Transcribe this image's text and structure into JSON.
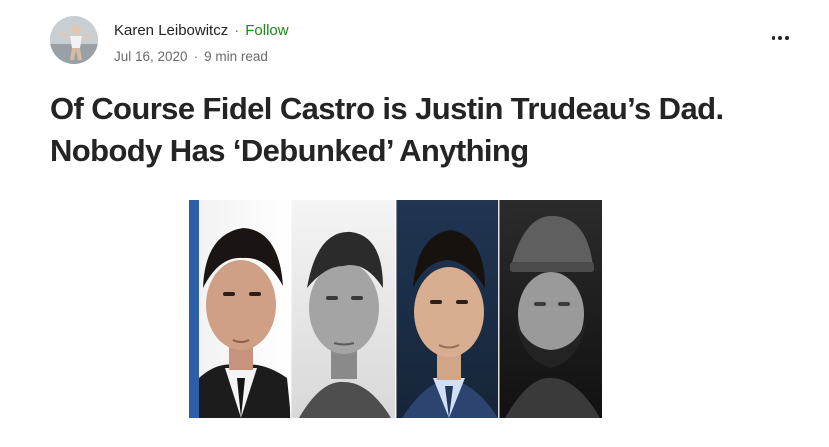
{
  "author": {
    "name": "Karen Leibowitcz",
    "separator": "·",
    "follow_label": "Follow"
  },
  "meta": {
    "date": "Jul 16, 2020",
    "separator": "·",
    "read_time": "9 min read"
  },
  "menu": {
    "icon": "more-horizontal-icon"
  },
  "article": {
    "title_line1": "Of Course Fidel Castro is Justin Trudeau’s Dad.",
    "title_line2": "Nobody Has ‘Debunked’ Anything",
    "hero_image": "four-portrait-composite"
  },
  "colors": {
    "text": "#242424",
    "muted": "#6b6b6b",
    "follow": "#1a8917"
  }
}
